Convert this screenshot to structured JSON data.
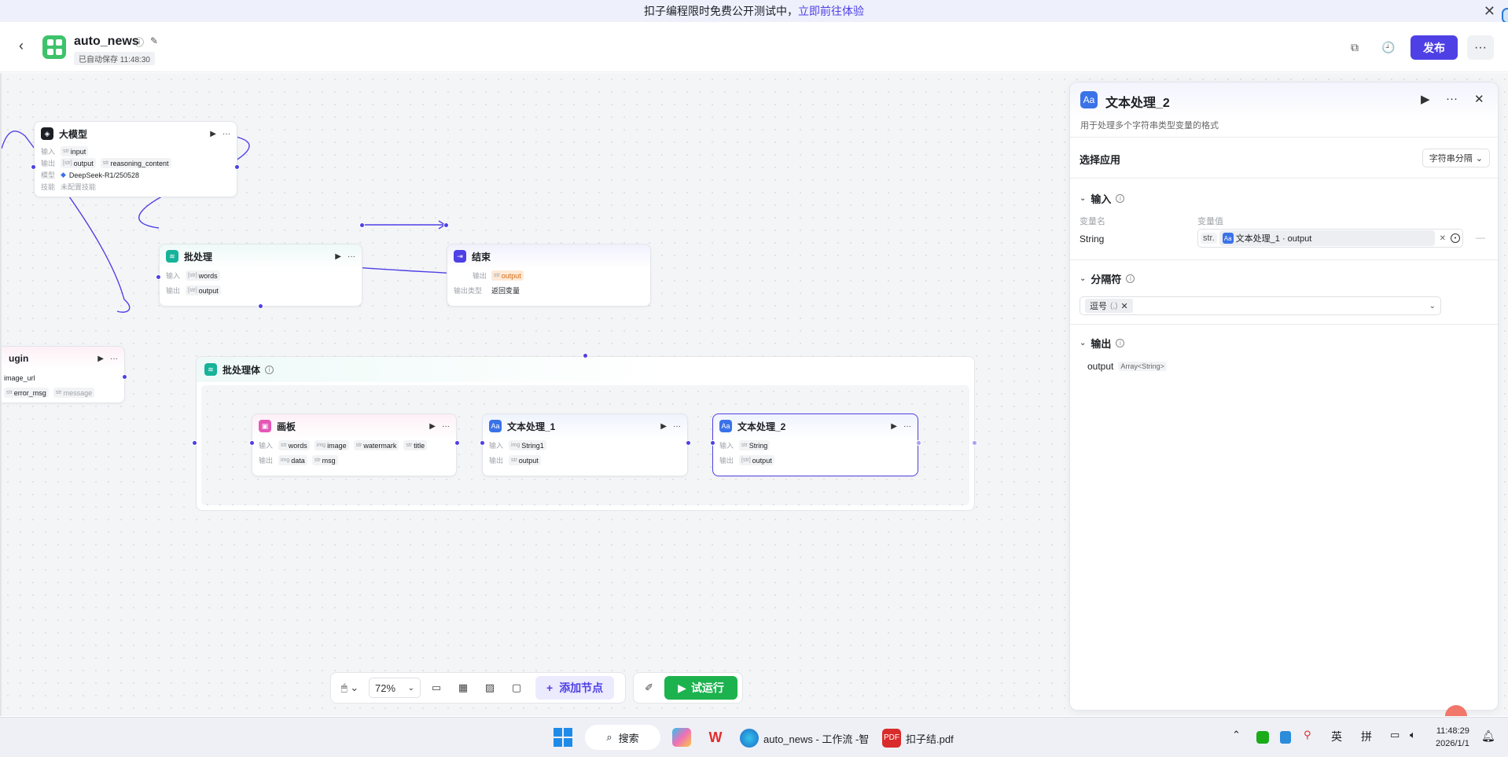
{
  "banner": {
    "text": "扣子编程限时免费公开测试中，",
    "link": "立即前往体验",
    "close_glyph": "✕"
  },
  "header": {
    "back_glyph": "‹",
    "app_title": "auto_news",
    "autosave": "已自动保存 11:48:30",
    "publish_label": "发布",
    "more_glyph": "···"
  },
  "nodes": {
    "llm": {
      "title": "大模型",
      "input_label": "输入",
      "input_tag": "input",
      "output_label": "输出",
      "output_tags": [
        "output",
        "reasoning_content"
      ],
      "model_label": "模型",
      "model_value": "DeepSeek-R1/250528",
      "skill_label": "技能",
      "skill_value": "未配置技能"
    },
    "batch": {
      "title": "批处理",
      "input_label": "输入",
      "input_tag": "words",
      "output_label": "输出",
      "output_tag": "output"
    },
    "end": {
      "title": "结束",
      "output_label": "输出",
      "output_tag": "output",
      "type_label": "输出类型",
      "type_value": "返回变量"
    },
    "plugin": {
      "title": "ugin",
      "input_tag": "image_url",
      "output_tags": [
        "error_msg",
        "message"
      ]
    },
    "batch_body": {
      "title": "批处理体"
    },
    "board": {
      "title": "画板",
      "input_label": "输入",
      "input_tags": [
        "words",
        "image",
        "watermark",
        "title"
      ],
      "output_label": "输出",
      "output_tags": [
        "data",
        "msg"
      ]
    },
    "text1": {
      "title": "文本处理_1",
      "input_label": "输入",
      "input_tag": "String1",
      "output_label": "输出",
      "output_tag": "output"
    },
    "text2": {
      "title": "文本处理_2",
      "input_label": "输入",
      "input_tag": "String",
      "output_label": "输出",
      "output_tag": "output"
    }
  },
  "toolbar": {
    "zoom": "72%",
    "add_node": "添加节点",
    "run": "试运行"
  },
  "panel": {
    "title": "文本处理_2",
    "description": "用于处理多个字符串类型变量的格式",
    "select_app_label": "选择应用",
    "select_app_value": "字符串分隔",
    "input_section": "输入",
    "var_name_header": "变量名",
    "var_value_header": "变量值",
    "var_name": "String",
    "var_type": "str.",
    "var_ref": "文本处理_1 · output",
    "separator_section": "分隔符",
    "separator_chip": "逗号",
    "separator_symbol": "(,)",
    "output_section": "输出",
    "output_name": "output",
    "output_type": "Array<String>"
  },
  "taskbar": {
    "search": "搜索",
    "edge_title": "auto_news - 工作流 -智",
    "pdf_title": "扣子结.pdf",
    "ime1": "英",
    "ime2": "拼",
    "time": "11:48:29",
    "date": "2026/1/1"
  },
  "colors": {
    "accent": "#4e40e5",
    "run_green": "#1cb24e",
    "edge": "#4e40e5"
  }
}
